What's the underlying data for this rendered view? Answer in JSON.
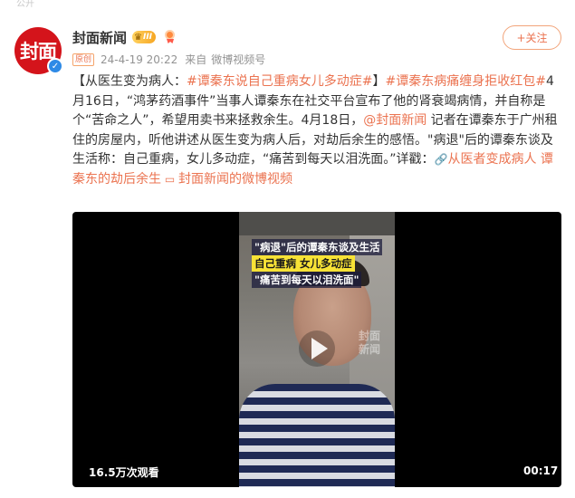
{
  "page": {
    "top_partial": "公开"
  },
  "author": {
    "avatar_text": "封面",
    "name": "封面新闻",
    "vip_level": "III",
    "original_tag": "原创",
    "timestamp": "24-4-19 20:22",
    "source_prefix": "来自",
    "source": "微博视频号",
    "follow_label": "+关注"
  },
  "post": {
    "bracket_open": "【从医生变为病人：",
    "topic1": "#谭秦东说自己重病女儿多动症#",
    "bracket_close": "】",
    "topic2": "#谭秦东病痛缠身拒收红包#",
    "body1": "4月16日，“鸿茅药酒事件”当事人谭秦东在社交平台宣布了他的肾衰竭病情，并自称是个“苦命之人”，希望用卖书来拯救余生。4月18日，",
    "mention": "@封面新闻",
    "body2": " 记者在谭秦东于广州租住的房屋内，听他讲述从医生变为病人后，对劫后余生的感悟。\"病退\"后的谭秦东谈及生活称：自己重病，女儿多动症，“痛苦到每天以泪洗面。”详戳：",
    "link_text": "从医者变成病人 谭秦东的劫后余生",
    "video_link_text": "封面新闻的微博视频"
  },
  "video": {
    "caption1": "\"病退\"后的谭秦东谈及生活",
    "caption2": "自己重病 女儿多动症",
    "caption3": "\"痛苦到每天以泪洗面\"",
    "watermark": "封面\n新闻",
    "views": "16.5万次观看",
    "duration": "00:17"
  }
}
